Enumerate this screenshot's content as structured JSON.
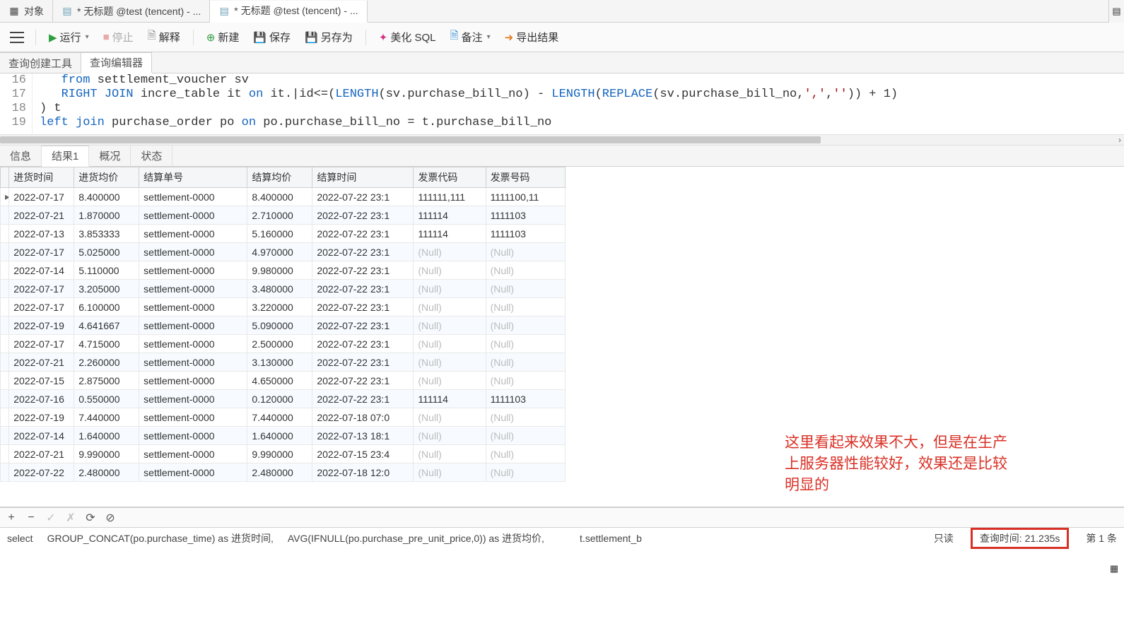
{
  "top_tabs": {
    "items": [
      {
        "label": "对象",
        "icon": "table-icon"
      },
      {
        "label": "* 无标题 @test (tencent) - ...",
        "icon": "sql-icon"
      },
      {
        "label": "* 无标题 @test (tencent) - ...",
        "icon": "sql-icon",
        "active": true
      }
    ]
  },
  "toolbar": {
    "run": "运行",
    "stop": "停止",
    "explain": "解释",
    "new": "新建",
    "save": "保存",
    "save_as": "另存为",
    "beautify": "美化 SQL",
    "notes": "备注",
    "export": "导出结果"
  },
  "sub_tabs": {
    "builder": "查询创建工具",
    "editor": "查询编辑器"
  },
  "sql": {
    "lines": [
      {
        "n": "16",
        "html": "   <span class='kw'>from</span> settlement_voucher sv"
      },
      {
        "n": "17",
        "html": "   <span class='kw'>RIGHT JOIN</span> incre_table it <span class='kw'>on</span> it.|id&lt;=(<span class='fn'>LENGTH</span>(sv.purchase_bill_no) - <span class='fn'>LENGTH</span>(<span class='fn'>REPLACE</span>(sv.purchase_bill_no,<span class='str'>','</span>,<span class='str'>''</span>)) + 1)"
      },
      {
        "n": "18",
        "html": ") t"
      },
      {
        "n": "19",
        "html": "<span class='kw'>left join</span> purchase_order po <span class='kw'>on</span> po.purchase_bill_no = t.purchase_bill_no"
      }
    ]
  },
  "result_tabs": {
    "info": "信息",
    "result1": "结果1",
    "overview": "概况",
    "status": "状态"
  },
  "grid": {
    "columns": [
      "进货时间",
      "进货均价",
      "结算单号",
      "结算均价",
      "结算时间",
      "发票代码",
      "发票号码"
    ],
    "rows": [
      [
        "2022-07-17",
        "8.400000",
        "settlement-0000",
        "8.400000",
        "2022-07-22 23:1",
        "111111,111",
        "1111100,11"
      ],
      [
        "2022-07-21",
        "1.870000",
        "settlement-0000",
        "2.710000",
        "2022-07-22 23:1",
        "111114",
        "1111103"
      ],
      [
        "2022-07-13",
        "3.853333",
        "settlement-0000",
        "5.160000",
        "2022-07-22 23:1",
        "111114",
        "1111103"
      ],
      [
        "2022-07-17",
        "5.025000",
        "settlement-0000",
        "4.970000",
        "2022-07-22 23:1",
        "(Null)",
        "(Null)"
      ],
      [
        "2022-07-14",
        "5.110000",
        "settlement-0000",
        "9.980000",
        "2022-07-22 23:1",
        "(Null)",
        "(Null)"
      ],
      [
        "2022-07-17",
        "3.205000",
        "settlement-0000",
        "3.480000",
        "2022-07-22 23:1",
        "(Null)",
        "(Null)"
      ],
      [
        "2022-07-17",
        "6.100000",
        "settlement-0000",
        "3.220000",
        "2022-07-22 23:1",
        "(Null)",
        "(Null)"
      ],
      [
        "2022-07-19",
        "4.641667",
        "settlement-0000",
        "5.090000",
        "2022-07-22 23:1",
        "(Null)",
        "(Null)"
      ],
      [
        "2022-07-17",
        "4.715000",
        "settlement-0000",
        "2.500000",
        "2022-07-22 23:1",
        "(Null)",
        "(Null)"
      ],
      [
        "2022-07-21",
        "2.260000",
        "settlement-0000",
        "3.130000",
        "2022-07-22 23:1",
        "(Null)",
        "(Null)"
      ],
      [
        "2022-07-15",
        "2.875000",
        "settlement-0000",
        "4.650000",
        "2022-07-22 23:1",
        "(Null)",
        "(Null)"
      ],
      [
        "2022-07-16",
        "0.550000",
        "settlement-0000",
        "0.120000",
        "2022-07-22 23:1",
        "111114",
        "1111103"
      ],
      [
        "2022-07-19",
        "7.440000",
        "settlement-0000",
        "7.440000",
        "2022-07-18 07:0",
        "(Null)",
        "(Null)"
      ],
      [
        "2022-07-14",
        "1.640000",
        "settlement-0000",
        "1.640000",
        "2022-07-13 18:1",
        "(Null)",
        "(Null)"
      ],
      [
        "2022-07-21",
        "9.990000",
        "settlement-0000",
        "9.990000",
        "2022-07-15 23:4",
        "(Null)",
        "(Null)"
      ],
      [
        "2022-07-22",
        "2.480000",
        "settlement-0000",
        "2.480000",
        "2022-07-18 12:0",
        "(Null)",
        "(Null)"
      ]
    ]
  },
  "footer": {
    "sql_preview_left": "select",
    "sql_preview_mid1": "GROUP_CONCAT(po.purchase_time) as 进货时间,",
    "sql_preview_mid2": "AVG(IFNULL(po.purchase_pre_unit_price,0)) as 进货均价,",
    "sql_preview_mid3": "t.settlement_b",
    "readonly": "只读",
    "query_time": "查询时间: 21.235s",
    "record_pos": "第 1 条"
  },
  "annotation": {
    "text": "这里看起来效果不大，但是在生产上服务器性能较好，效果还是比较明显的"
  }
}
